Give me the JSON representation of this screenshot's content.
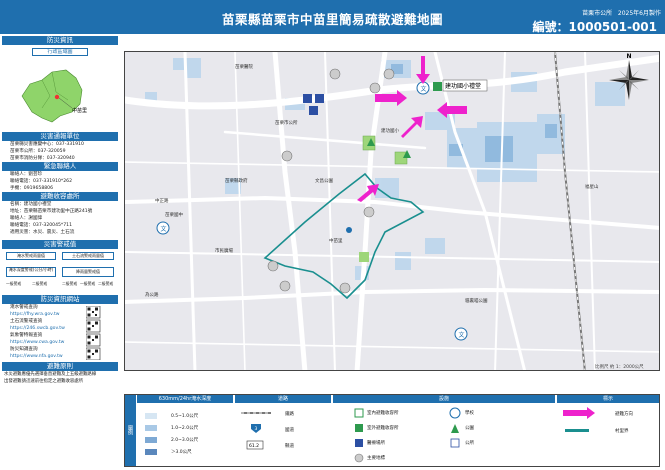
{
  "header": {
    "title": "苗栗縣苗栗市中苗里簡易疏散避難地圖",
    "issuer": "苗栗市公所",
    "date": "2025年6月製作",
    "code": "編號：1000501-001"
  },
  "left": {
    "section1": "防災資訊",
    "admin_sub": "行政區域圖",
    "inset_label": "中苗里",
    "reporting_title": "災害通報單位",
    "reporting": [
      "苗栗縣災害應變中心：037-331910",
      "苗栗市公所：037-320059",
      "苗栗市消防分隊：037-320940"
    ],
    "contact_title": "緊急聯絡人",
    "contact": [
      "聯絡人：劉芸珍",
      "聯絡電話：037-331910*262",
      "手機：0919658806"
    ],
    "shelter_title": "避難收容處所",
    "shelter": [
      "名稱：建功國小禮堂",
      "地址：苗栗縣苗栗市建功里中正路241號",
      "聯絡人：謝國偉",
      "聯絡電話：037-320045*711",
      "適用災害：水災、震災、土石流"
    ],
    "alert_title": "災害警戒值",
    "alert_labels": [
      "淹水警戒雨量值",
      "土石流警戒雨量值",
      "淹水深度警戒(公分/小時)",
      "降雨量警戒值"
    ],
    "alert_row": [
      "一級警戒",
      "二級警戒",
      "二級警戒",
      "一級警戒",
      "二級警戒"
    ],
    "query_title": "防災資訊網站",
    "query": [
      "淹水警戒查詢",
      "https://fhy.wra.gov.tw",
      "土石流警戒查詢",
      "https://246.swcb.gov.tw",
      "氣象警特報查詢",
      "https://www.cwa.gov.tw",
      "防災知識查詢",
      "https://www.nfa.gov.tw"
    ],
    "notes_title": "避難原則",
    "notes": [
      "水災避難應優先選擇垂直避難及上五級避難路線",
      "出發避難請迅速前往指定之避難收容處所"
    ]
  },
  "map": {
    "scale_text": "比例尺 約 1：2000公尺",
    "labels": [
      "苗栗醫院",
      "建功國小",
      "苗栗國中",
      "中苗里",
      "苗栗市公所",
      "苗栗縣政府",
      "中正路",
      "為公路",
      "文昌公園",
      "市民廣場",
      "福星山",
      "貓裏喵公園"
    ],
    "shelter_label": "建功國小禮堂",
    "compass": "N"
  },
  "legend": {
    "flood_title": "630mm/24hr淹水深度",
    "flood": [
      "0.5~1.0公尺",
      "1.0~2.0公尺",
      "2.0~3.0公尺",
      "＞3.0公尺"
    ],
    "road_title": "道路",
    "roads": [
      "鐵路",
      "國道",
      "縣道"
    ],
    "road_badges": [
      "3",
      "61.2"
    ],
    "fac_title": "設施",
    "fac": [
      "室內避難收容所",
      "室外避難收容所",
      "醫療場所",
      "主要地標",
      "學校",
      "公園",
      "公所"
    ],
    "mark_title": "標示",
    "marks": [
      "避難方向",
      "村里界"
    ],
    "side_label": "圖例",
    "colors": {
      "flood1": "#d6e6f3",
      "flood2": "#a9c9e6",
      "flood3": "#7ea9d4",
      "flood4": "#5a87bc",
      "arrow": "#ee22cc",
      "boundary": "#1a8f8f",
      "blue": "#1f6fae"
    }
  }
}
